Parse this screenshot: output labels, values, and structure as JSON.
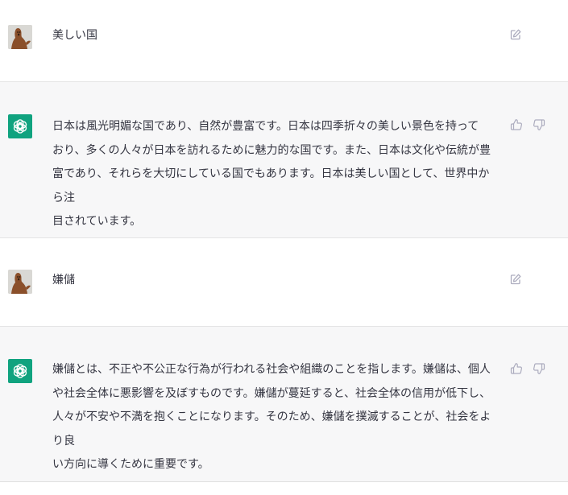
{
  "conversation": {
    "messages": [
      {
        "role": "user",
        "text": "美しい国",
        "actions": {
          "edit_icon": "edit-icon"
        }
      },
      {
        "role": "assistant",
        "text": "日本は風光明媚な国であり、自然が豊富です。日本は四季折々の美しい景色を持って\nおり、多くの人々が日本を訪れるために魅力的な国です。また、日本は文化や伝統が豊\n富であり、それらを大切にしている国でもあります。日本は美しい国として、世界中から注\n目されています。",
        "actions": {
          "like_icon": "thumbs-up-icon",
          "dislike_icon": "thumbs-down-icon"
        }
      },
      {
        "role": "user",
        "text": "嫌儲",
        "actions": {
          "edit_icon": "edit-icon"
        }
      },
      {
        "role": "assistant",
        "text": "嫌儲とは、不正や不公正な行為が行われる社会や組織のことを指します。嫌儲は、個人\nや社会全体に悪影響を及ぼすものです。嫌儲が蔓延すると、社会全体の信用が低下し、\n人々が不安や不満を抱くことになります。そのため、嫌儲を撲滅することが、社会をより良\nい方向に導くために重要です。",
        "actions": {
          "like_icon": "thumbs-up-icon",
          "dislike_icon": "thumbs-down-icon"
        }
      }
    ]
  },
  "colors": {
    "assistant_avatar_bg": "#10a37f",
    "assistant_row_bg": "#f7f7f8",
    "text": "#343541",
    "icon": "#acacbe"
  }
}
